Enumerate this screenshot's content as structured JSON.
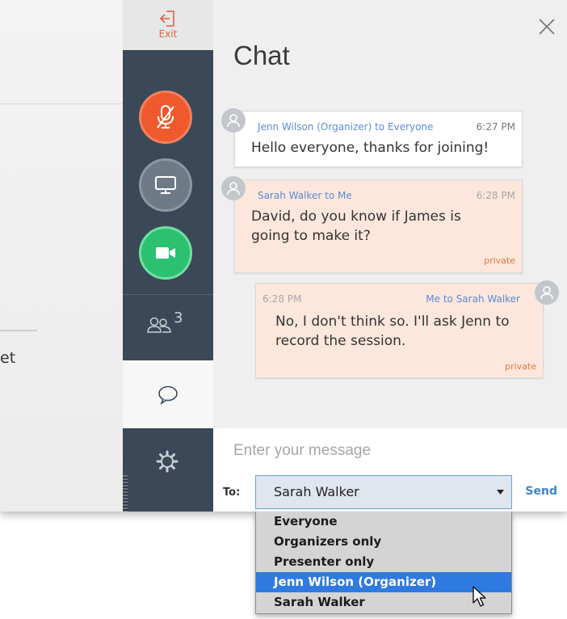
{
  "rail": {
    "exit_label": "Exit",
    "attendee_count": "3"
  },
  "chat": {
    "title": "Chat",
    "messages": [
      {
        "header": "Jenn Wilson (Organizer) to Everyone",
        "time": "6:27 PM",
        "text": "Hello everyone, thanks for joining!"
      },
      {
        "header": "Sarah Walker to Me",
        "time": "6:28 PM",
        "text": "David, do you know if James is going to make it?",
        "tag": "private"
      },
      {
        "header": "Me to Sarah Walker",
        "time": "6:28 PM",
        "text": "No, I don't think so. I'll ask Jenn to record the session.",
        "tag": "private"
      }
    ],
    "input": {
      "placeholder": "Enter your message",
      "value": ""
    },
    "to_label": "To:",
    "recipient_selected": "Sarah Walker",
    "send_label": "Send",
    "recipient_options": [
      "Everyone",
      "Organizers only",
      "Presenter only",
      "Jenn Wilson (Organizer)",
      "Sarah Walker"
    ]
  },
  "background": {
    "fragment_text": "et"
  },
  "colors": {
    "rail_dark": "#3b4857",
    "mic_muted": "#ee5a2d",
    "screen_share": "#6f7a87",
    "video": "#2cc071",
    "accent_blue": "#3a86c8",
    "private_bubble": "#fde7dc",
    "private_tag": "#e5763f",
    "dropdown_highlight": "#2f7ae0"
  },
  "icons": {
    "exit": "exit-icon",
    "mic": "mic-muted-icon",
    "screen": "monitor-icon",
    "video": "video-camera-icon",
    "people": "people-icon",
    "chat": "chat-bubble-icon",
    "settings": "gear-icon",
    "close": "close-icon",
    "avatar": "user-avatar-icon",
    "dropdown_arrow": "caret-down-icon",
    "cursor": "mouse-cursor-icon"
  }
}
